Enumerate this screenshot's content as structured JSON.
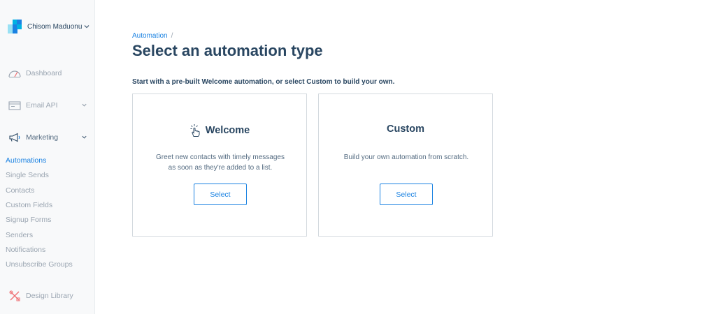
{
  "account": {
    "name": "Chisom Maduonu",
    "icon": "chevron-down-icon"
  },
  "brand_colors": {
    "primary": "#1a82e2",
    "dark": "#294661",
    "muted": "#9aa5b1"
  },
  "nav": {
    "items": [
      {
        "label": "Dashboard",
        "icon": "speedometer-icon"
      },
      {
        "label": "Email API",
        "icon": "email-api-icon"
      },
      {
        "label": "Marketing",
        "icon": "megaphone-icon"
      }
    ],
    "marketing_subitems": [
      {
        "label": "Automations",
        "active": true
      },
      {
        "label": "Single Sends"
      },
      {
        "label": "Contacts"
      },
      {
        "label": "Custom Fields"
      },
      {
        "label": "Signup Forms"
      },
      {
        "label": "Senders"
      },
      {
        "label": "Notifications"
      },
      {
        "label": "Unsubscribe Groups"
      }
    ],
    "design_library": {
      "label": "Design Library",
      "icon": "design-tools-icon"
    }
  },
  "breadcrumb": {
    "parent": "Automation",
    "separator": "/"
  },
  "page": {
    "title": "Select an automation type",
    "intro": "Start with a pre-built Welcome automation, or select Custom to build your own."
  },
  "cards": [
    {
      "title": "Welcome",
      "icon": "pointer-hand-icon",
      "desc_line1": "Greet new contacts with timely messages",
      "desc_line2": "as soon as they're added to a list.",
      "button": "Select"
    },
    {
      "title": "Custom",
      "desc_line1": "Build your own automation from scratch.",
      "button": "Select"
    }
  ]
}
